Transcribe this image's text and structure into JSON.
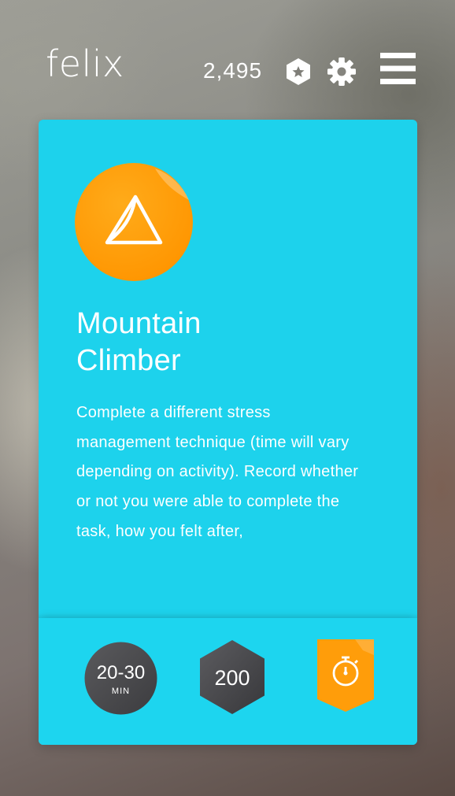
{
  "app": {
    "logo_text": "felix",
    "points_total": "2,495"
  },
  "icons": {
    "badge": "badge-star-icon",
    "settings": "gear-icon",
    "menu": "hamburger-menu-icon",
    "challenge": "mountain-icon",
    "timer": "stopwatch-icon"
  },
  "challenge": {
    "title_line1": "Mountain",
    "title_line2": "Climber",
    "description": "Complete a different stress management technique (time will vary depending on activity). Record whether or not you were able to complete the task, how you felt after,",
    "duration_value": "20-30",
    "duration_unit": "MIN",
    "reward_points": "200"
  },
  "colors": {
    "card": "#1dd2ec",
    "accent_orange": "#ff9a00",
    "chip_dark": "#4a4a4d"
  }
}
